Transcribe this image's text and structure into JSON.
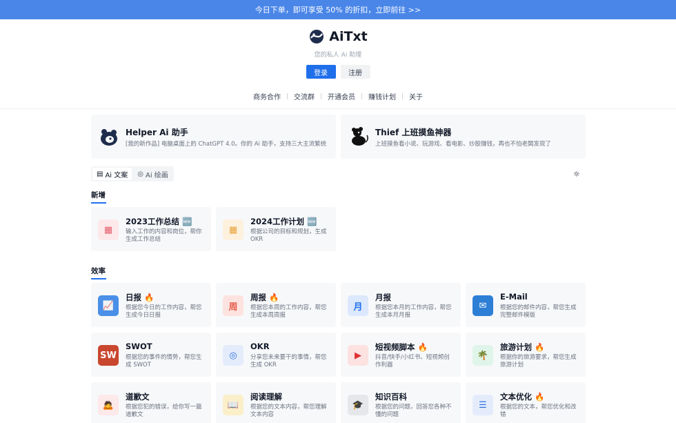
{
  "banner": {
    "text": "今日下单，即可享受 50% 的折扣，立即前往 >>"
  },
  "header": {
    "brand": "AiTxt",
    "tagline": "您的私人 Ai 助理",
    "login": "登录",
    "register": "注册",
    "nav": [
      "商务合作",
      "交流群",
      "开通会员",
      "赚钱计划",
      "关于"
    ]
  },
  "promos": [
    {
      "title": "Helper Ai 助手",
      "desc": "[我的新作品] 电脑桌面上的 ChatGPT 4.0。你的 Ai 助手，支持三大主流繁统",
      "icon": "panda-icon"
    },
    {
      "title": "Thief 上班摸鱼神器",
      "desc": "上班摸鱼看小说、玩游戏、看电影、炒股赚钱，再也不怕老闆发现了",
      "icon": "mouse-icon"
    }
  ],
  "tabs": [
    {
      "label": "Ai 文案",
      "glyph": "▤",
      "active": true
    },
    {
      "label": "Ai 绘画",
      "glyph": "◎",
      "active": false
    }
  ],
  "sections": [
    {
      "title": "新增",
      "cards": [
        {
          "title": "2023工作总结 🆕",
          "desc": "输入工作的内容和岗位，帮你生成工作总结",
          "icon": "report-icon",
          "glyph": "▦",
          "color": "#e35d6a",
          "bg": "#fde8ea"
        },
        {
          "title": "2024工作计划 🆕",
          "desc": "根据公司的目标和规划，生成 OKR",
          "icon": "calendar-icon",
          "glyph": "▦",
          "color": "#e8a13a",
          "bg": "#fdf1de"
        }
      ]
    },
    {
      "title": "效率",
      "cards": [
        {
          "title": "日报 🔥",
          "desc": "根据您今日的工作内容，帮您生成今日日报",
          "icon": "chart-icon",
          "glyph": "📈",
          "color": "#ffffff",
          "bg": "#4a8fe8"
        },
        {
          "title": "周报 🔥",
          "desc": "根据您本周的工作内容，帮您生成本周周报",
          "icon": "week-icon",
          "glyph": "周",
          "color": "#e35d4a",
          "bg": "#fde3df"
        },
        {
          "title": "月报",
          "desc": "根据您本月的工作内容，帮您生成本月月报",
          "icon": "month-icon",
          "glyph": "月",
          "color": "#1f6feb",
          "bg": "#dbe8fd"
        },
        {
          "title": "E-Mail",
          "desc": "根据您的邮件内容，帮您生成完整邮件模版",
          "icon": "mail-icon",
          "glyph": "✉",
          "color": "#ffffff",
          "bg": "#2d7fd6"
        },
        {
          "title": "SWOT",
          "desc": "根据您的事件的情势，帮您生成 SWOT",
          "icon": "swot-icon",
          "glyph": "SW",
          "color": "#ffffff",
          "bg": "#c9472f"
        },
        {
          "title": "OKR",
          "desc": "分享您未来要干的事情，帮您生成 OKR",
          "icon": "target-icon",
          "glyph": "◎",
          "color": "#2f6fe0",
          "bg": "#e4ecfc"
        },
        {
          "title": "短视频脚本 🔥",
          "desc": "抖音/快手/小红书、短视频创作利器",
          "icon": "video-icon",
          "glyph": "▶",
          "color": "#e03131",
          "bg": "#fde2e2"
        },
        {
          "title": "旅游计划 🔥",
          "desc": "根据你的旅游要求，帮您生成旅游计划",
          "icon": "palm-icon",
          "glyph": "🌴",
          "color": "#0f9d58",
          "bg": "#e0f5ea"
        },
        {
          "title": "道歉文",
          "desc": "根据您犯的错误，给你写一篇道歉文",
          "icon": "apology-icon",
          "glyph": "🙇",
          "color": "#e35d6a",
          "bg": "#fde8ea"
        },
        {
          "title": "阅读理解",
          "desc": "根据您的文本内容，帮您理解文本内容",
          "icon": "reading-icon",
          "glyph": "📖",
          "color": "#8a6d1f",
          "bg": "#fbefc9"
        },
        {
          "title": "知识百科",
          "desc": "根据您的问题，回答您各种不懂的问题",
          "icon": "graduation-icon",
          "glyph": "🎓",
          "color": "#1f2937",
          "bg": "#e5e7eb"
        },
        {
          "title": "文本优化 🔥",
          "desc": "根据您的文本，帮您优化和改错",
          "icon": "list-icon",
          "glyph": "☰",
          "color": "#2f6fe0",
          "bg": "#e4ecfc"
        }
      ]
    }
  ]
}
